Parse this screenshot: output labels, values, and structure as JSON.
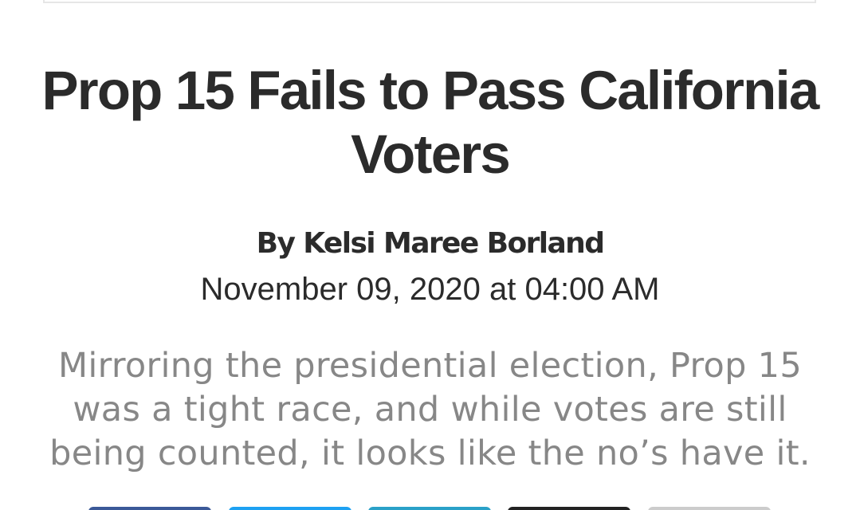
{
  "article": {
    "title": "Prop 15 Fails to Pass California Voters",
    "byline": "By Kelsi Maree Borland",
    "date": "November 09, 2020 at 04:00 AM",
    "summary": "Mirroring the presidential election, Prop 15 was a tight race, and while votes are still being counted, it looks like the no’s have it."
  },
  "share": {
    "buttons": [
      {
        "icon": "facebook-icon",
        "color": "#3b5998"
      },
      {
        "icon": "twitter-icon",
        "color": "#1da1f2"
      },
      {
        "icon": "linkedin-icon",
        "color": "#2aa1c8"
      },
      {
        "icon": "email-icon",
        "color": "#222222"
      },
      {
        "icon": "more-icon",
        "color": "#cccccc"
      }
    ]
  },
  "colors": {
    "headline": "#2b2b2b",
    "summary": "#878787"
  }
}
